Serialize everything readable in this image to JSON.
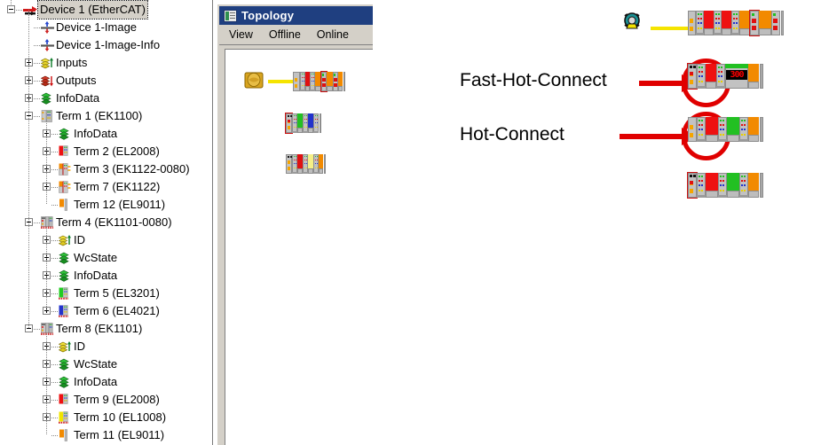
{
  "tree": {
    "name": "ethercat-device-tree",
    "items": [
      {
        "label": "Device 1 (EtherCAT)",
        "depth": 0,
        "icon": "ethercat-device-icon",
        "expander": "minus",
        "selected": true
      },
      {
        "label": "Device 1-Image",
        "depth": 1,
        "icon": "process-image-icon",
        "expander": "none",
        "selected": false
      },
      {
        "label": "Device 1-Image-Info",
        "depth": 1,
        "icon": "process-image-icon",
        "expander": "none",
        "selected": false
      },
      {
        "label": "Inputs",
        "depth": 1,
        "icon": "inputs-icon",
        "expander": "plus",
        "selected": false
      },
      {
        "label": "Outputs",
        "depth": 1,
        "icon": "outputs-icon",
        "expander": "plus",
        "selected": false
      },
      {
        "label": "InfoData",
        "depth": 1,
        "icon": "infodata-icon",
        "expander": "plus",
        "selected": false
      },
      {
        "label": "Term 1 (EK1100)",
        "depth": 1,
        "icon": "coupler-grey-icon",
        "expander": "minus",
        "selected": false
      },
      {
        "label": "InfoData",
        "depth": 2,
        "icon": "infodata-icon",
        "expander": "plus",
        "selected": false
      },
      {
        "label": "Term 2 (EL2008)",
        "depth": 2,
        "icon": "terminal-red-icon",
        "expander": "plus",
        "selected": false
      },
      {
        "label": "Term 3 (EK1122-0080)",
        "depth": 2,
        "icon": "junction-orange-icon",
        "expander": "plus",
        "selected": false
      },
      {
        "label": "Term 7 (EK1122)",
        "depth": 2,
        "icon": "junction-orange-icon",
        "expander": "plus",
        "selected": false
      },
      {
        "label": "Term 12 (EL9011)",
        "depth": 2,
        "icon": "endcap-orange-icon",
        "expander": "none",
        "selected": false
      },
      {
        "label": "Term 4 (EK1101-0080)",
        "depth": 1,
        "icon": "coupler-hot-icon",
        "expander": "minus",
        "selected": false
      },
      {
        "label": "ID",
        "depth": 2,
        "icon": "inputs-icon",
        "expander": "plus",
        "selected": false
      },
      {
        "label": "WcState",
        "depth": 2,
        "icon": "infodata-icon",
        "expander": "plus",
        "selected": false
      },
      {
        "label": "InfoData",
        "depth": 2,
        "icon": "infodata-icon",
        "expander": "plus",
        "selected": false
      },
      {
        "label": "Term 5 (EL3201)",
        "depth": 2,
        "icon": "terminal-green-icon",
        "expander": "plus",
        "selected": false
      },
      {
        "label": "Term 6 (EL4021)",
        "depth": 2,
        "icon": "terminal-blue-icon",
        "expander": "plus",
        "selected": false
      },
      {
        "label": "Term 8 (EK1101)",
        "depth": 1,
        "icon": "coupler-hot-icon",
        "expander": "minus",
        "selected": false
      },
      {
        "label": "ID",
        "depth": 2,
        "icon": "inputs-icon",
        "expander": "plus",
        "selected": false
      },
      {
        "label": "WcState",
        "depth": 2,
        "icon": "infodata-icon",
        "expander": "plus",
        "selected": false
      },
      {
        "label": "InfoData",
        "depth": 2,
        "icon": "infodata-icon",
        "expander": "plus",
        "selected": false
      },
      {
        "label": "Term 9 (EL2008)",
        "depth": 2,
        "icon": "terminal-red-icon",
        "expander": "plus",
        "selected": false
      },
      {
        "label": "Term 10 (EL1008)",
        "depth": 2,
        "icon": "terminal-yellow-icon",
        "expander": "plus",
        "selected": false
      },
      {
        "label": "Term 11 (EL9011)",
        "depth": 2,
        "icon": "endcap-orange-icon",
        "expander": "none",
        "selected": false
      }
    ]
  },
  "topology": {
    "title": "Topology",
    "title_icon": "topology-window-icon",
    "menu": [
      {
        "label": "View"
      },
      {
        "label": "Offline"
      },
      {
        "label": "Online"
      }
    ]
  },
  "diagram": {
    "annotations": [
      {
        "label": "Fast-Hot-Connect"
      },
      {
        "label": "Hot-Connect"
      }
    ],
    "display_value": "300"
  },
  "colors": {
    "titlebar": "#1f3f80",
    "window_face": "#d4d0c8",
    "annotation_red": "#e00000",
    "cable_yellow": "#f5e400",
    "selection": "#d4d0c8"
  }
}
